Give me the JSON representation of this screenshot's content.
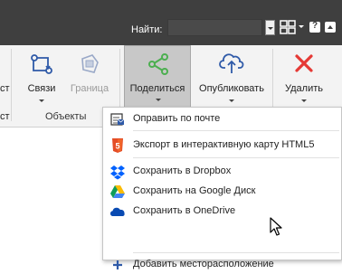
{
  "topbar": {
    "find_label": "Найти:"
  },
  "ribbon": {
    "partial_left_label": "ст",
    "partial_left_group": "ст",
    "buttons": [
      {
        "label": "Связи",
        "icon": "connections-icon"
      },
      {
        "label": "Граница",
        "icon": "boundary-icon"
      },
      {
        "label": "Поделиться",
        "icon": "share-icon"
      },
      {
        "label": "Опубликовать",
        "icon": "cloud-upload-icon"
      },
      {
        "label": "Удалить",
        "icon": "delete-icon"
      }
    ],
    "groups": [
      {
        "label": "Объекты"
      }
    ]
  },
  "share_menu": {
    "items": [
      {
        "label": "Оправить по почте",
        "icon": "mail-icon"
      },
      {
        "label": "Экспорт в интерактивную карту HTML5",
        "icon": "html5-icon"
      },
      {
        "label": "Сохранить в Dropbox",
        "icon": "dropbox-icon"
      },
      {
        "label": "Сохранить на Google Диск",
        "icon": "google-drive-icon"
      },
      {
        "label": "Сохранить в OneDrive",
        "icon": "onedrive-icon"
      },
      {
        "label": "Добавить месторасположение",
        "icon": "plus-icon"
      }
    ]
  },
  "colors": {
    "topbar": "#3f3f3f",
    "ribbon": "#f3f3f3",
    "share_icon": "#4caf50",
    "delete_icon": "#e53935",
    "accent_blue": "#2f5aa8"
  }
}
